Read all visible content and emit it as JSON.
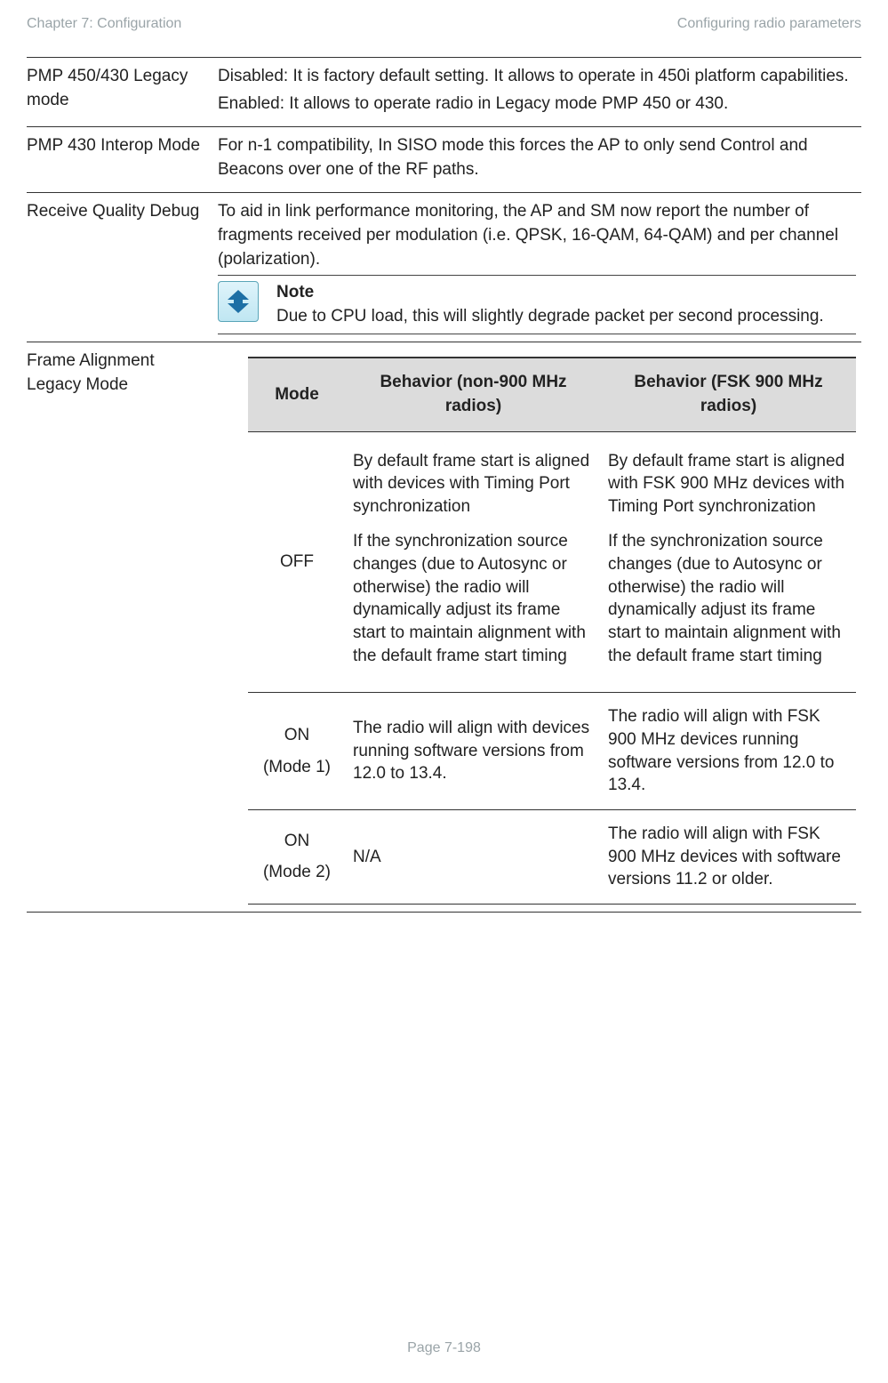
{
  "header": {
    "left": "Chapter 7:  Configuration",
    "right": "Configuring radio parameters"
  },
  "rows": {
    "r1": {
      "attr": "PMP 450/430 Legacy mode",
      "p1": "Disabled: It is factory default setting. It allows to operate in 450i platform capabilities.",
      "p2": "Enabled: It allows to operate radio in Legacy mode PMP 450 or 430."
    },
    "r2": {
      "attr": "PMP 430 Interop Mode",
      "p1": "For n-1 compatibility, In SISO mode this forces the AP to only send Control and Beacons over one of the RF paths."
    },
    "r3": {
      "attr": "Receive Quality Debug",
      "p1": "To aid in link performance monitoring, the AP and SM now report the number of fragments received per modulation (i.e. QPSK, 16-QAM, 64-QAM) and per channel (polarization).",
      "noteTitle": "Note",
      "noteBody": "Due to CPU load, this will slightly degrade packet per second processing."
    },
    "r4": {
      "attr": "Frame Alignment Legacy Mode",
      "headers": {
        "h1": "Mode",
        "h2": "Behavior (non-900 MHz radios)",
        "h3": "Behavior (FSK 900 MHz radios)"
      },
      "off": {
        "mode": "OFF",
        "c2a": "By default frame start is aligned with devices with Timing Port synchronization",
        "c2b": "If the synchronization source changes (due to Autosync or otherwise) the radio will dynamically adjust its frame start to maintain alignment with the default frame start timing",
        "c3a": "By default frame start is aligned with FSK 900 MHz devices with Timing Port synchronization",
        "c3b": "If the synchronization source changes (due to Autosync or otherwise) the radio will dynamically adjust its frame start to maintain alignment with the default frame start timing"
      },
      "on1": {
        "modeA": "ON",
        "modeB": "(Mode 1)",
        "c2": "The radio will align with devices running software versions from 12.0 to 13.4.",
        "c3": "The radio will align with FSK 900 MHz devices running software versions from 12.0 to 13.4."
      },
      "on2": {
        "modeA": "ON",
        "modeB": "(Mode 2)",
        "c2": "N/A",
        "c3": "The radio will align with FSK 900 MHz devices with software versions 11.2 or older."
      }
    }
  },
  "footer": "Page 7-198"
}
